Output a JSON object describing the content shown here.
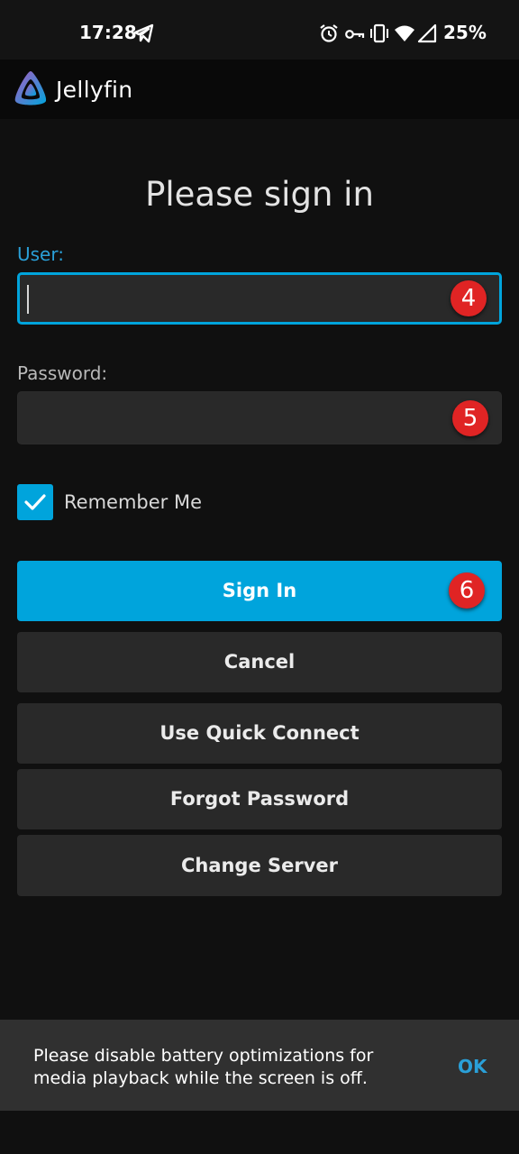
{
  "status_bar": {
    "time": "17:28",
    "battery": "25%",
    "icons": [
      "telegram-icon",
      "alarm-icon",
      "vpn-key-icon",
      "vibrate-icon",
      "wifi-icon",
      "signal-icon"
    ]
  },
  "app": {
    "title": "Jellyfin",
    "accent_color": "#00a4dc"
  },
  "form": {
    "heading": "Please sign in",
    "user_label": "User:",
    "user_value": "",
    "password_label": "Password:",
    "password_value": "",
    "remember_me_label": "Remember Me",
    "remember_me_checked": true
  },
  "badges": {
    "user": "4",
    "password": "5",
    "sign_in": "6"
  },
  "buttons": {
    "sign_in": "Sign In",
    "cancel": "Cancel",
    "quick_connect": "Use Quick Connect",
    "forgot_password": "Forgot Password",
    "change_server": "Change Server"
  },
  "snackbar": {
    "message": "Please disable battery optimizations for media playback while the screen is off.",
    "action": "OK"
  }
}
